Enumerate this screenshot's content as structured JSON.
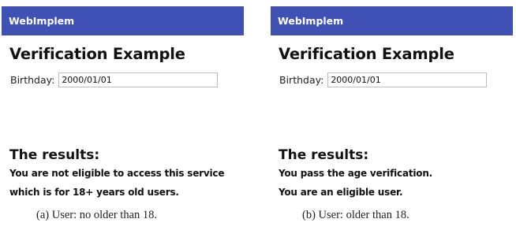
{
  "panels": [
    {
      "app_title": "WebImplem",
      "page_title": "Verification Example",
      "birthday_label": "Birthday:",
      "birthday_value": "2000/01/01",
      "results_title": "The results:",
      "result_lines": [
        "You are not eligible to access this service",
        "which is for 18+ years old users."
      ],
      "caption": "(a) User: no older than 18."
    },
    {
      "app_title": "WebImplem",
      "page_title": "Verification Example",
      "birthday_label": "Birthday:",
      "birthday_value": "2000/01/01",
      "results_title": "The results:",
      "result_lines": [
        "You pass the age verification.",
        "You are an eligible user."
      ],
      "caption": "(b) User: older than 18."
    }
  ],
  "colors": {
    "appbar_background": "#3f51b5",
    "appbar_text": "#ffffff"
  }
}
